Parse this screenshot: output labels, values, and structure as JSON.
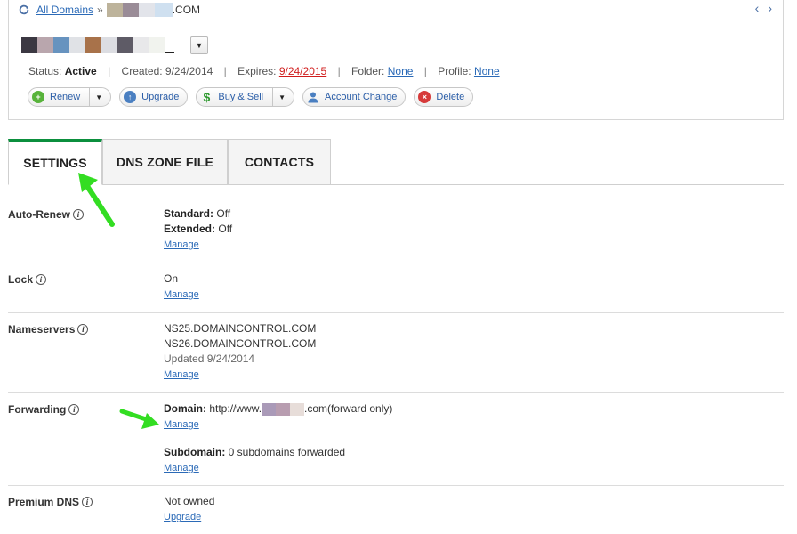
{
  "breadcrumb": {
    "link": "All Domains",
    "sep": "»",
    "tld": ".COM"
  },
  "domain": {
    "status_label": "Status:",
    "status": "Active",
    "created_label": "Created:",
    "created": "9/24/2014",
    "expires_label": "Expires:",
    "expires": "9/24/2015",
    "folder_label": "Folder:",
    "folder": "None",
    "profile_label": "Profile:",
    "profile": "None"
  },
  "actions": {
    "renew": "Renew",
    "upgrade": "Upgrade",
    "buy_sell": "Buy & Sell",
    "account_change": "Account Change",
    "delete": "Delete"
  },
  "tabs": {
    "settings": "SETTINGS",
    "dns": "DNS ZONE FILE",
    "contacts": "CONTACTS"
  },
  "settings": {
    "auto_renew": {
      "label": "Auto-Renew",
      "standard_k": "Standard:",
      "standard_v": "Off",
      "extended_k": "Extended:",
      "extended_v": "Off",
      "manage": "Manage"
    },
    "lock": {
      "label": "Lock",
      "value": "On",
      "manage": "Manage"
    },
    "nameservers": {
      "label": "Nameservers",
      "ns1": "NS25.DOMAINCONTROL.COM",
      "ns2": "NS26.DOMAINCONTROL.COM",
      "updated": "Updated 9/24/2014",
      "manage": "Manage"
    },
    "forwarding": {
      "label": "Forwarding",
      "domain_k": "Domain:",
      "domain_prefix": "http://www.",
      "domain_suffix": ".com(forward only)",
      "manage1": "Manage",
      "subdomain_k": "Subdomain:",
      "subdomain_v": "0 subdomains forwarded",
      "manage2": "Manage"
    },
    "premium_dns": {
      "label": "Premium DNS",
      "value": "Not owned",
      "upgrade": "Upgrade"
    }
  },
  "colors": {
    "accent_green": "#0b8f3d",
    "arrow_green": "#33dd22",
    "link": "#2b6ab7",
    "expired_red": "#d01c1c"
  }
}
